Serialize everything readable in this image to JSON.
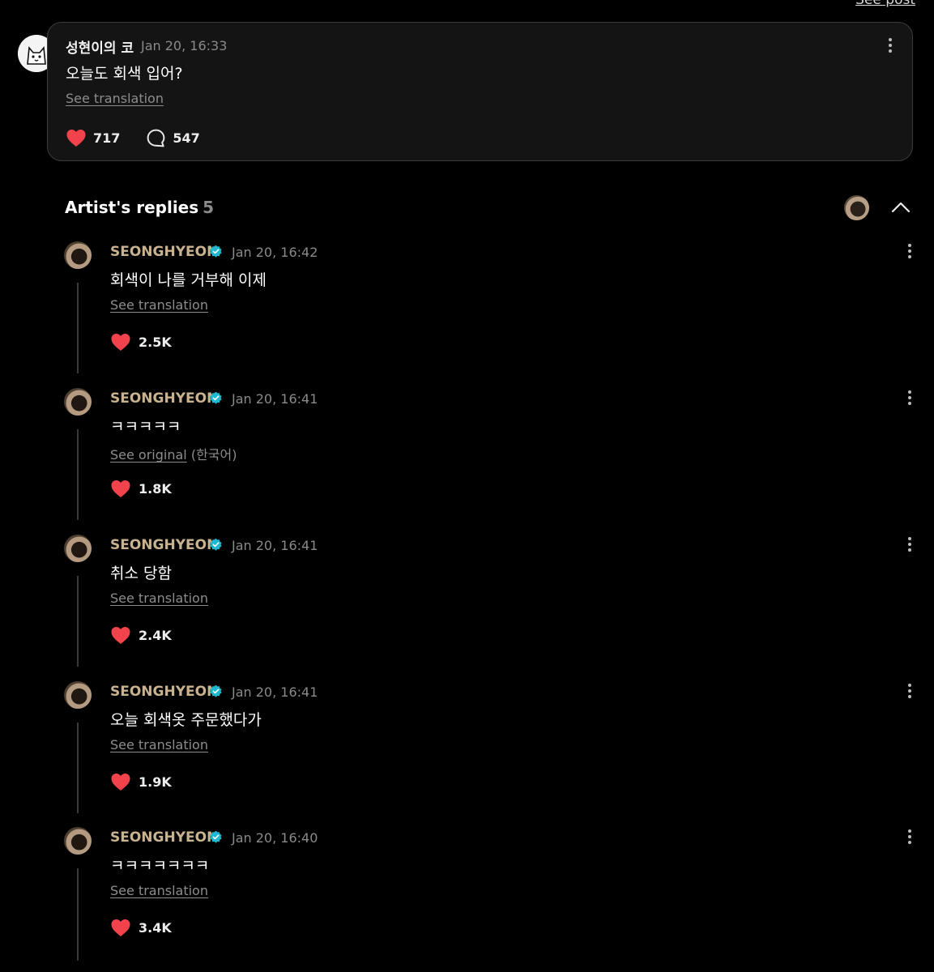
{
  "header": {
    "see_post": "See post"
  },
  "post": {
    "author": "성현이의 코",
    "time": "Jan 20, 16:33",
    "body": "오늘도 회색 입어?",
    "translation_link": "See translation",
    "likes": "717",
    "comments": "547"
  },
  "section": {
    "title": "Artist's replies",
    "count": "5"
  },
  "replies": [
    {
      "name": "SEONGHYEON",
      "time": "Jan 20, 16:42",
      "body": "회색이 나를 거부해 이제",
      "link": "See translation",
      "lang": "",
      "likes": "2.5K"
    },
    {
      "name": "SEONGHYEON",
      "time": "Jan 20, 16:41",
      "body": "ㅋㅋㅋㅋㅋ",
      "link": "See original",
      "lang": "(한국어)",
      "likes": "1.8K"
    },
    {
      "name": "SEONGHYEON",
      "time": "Jan 20, 16:41",
      "body": "취소 당함",
      "link": "See translation",
      "lang": "",
      "likes": "2.4K"
    },
    {
      "name": "SEONGHYEON",
      "time": "Jan 20, 16:41",
      "body": "오늘 회색옷 주문했다가",
      "link": "See translation",
      "lang": "",
      "likes": "1.9K"
    },
    {
      "name": "SEONGHYEON",
      "time": "Jan 20, 16:40",
      "body": "ㅋㅋㅋㅋㅋㅋㅋ",
      "link": "See translation",
      "lang": "",
      "likes": "3.4K"
    }
  ],
  "colors": {
    "heart": "#f2434c",
    "artist_name": "#c9b28f",
    "verified": "#1fb8d1",
    "background": "#000000"
  },
  "icons": {
    "like": "heart-icon",
    "comment": "comment-bubble-icon",
    "more": "more-vertical-icon",
    "collapse": "chevron-up-icon",
    "verified": "verified-badge-icon"
  }
}
